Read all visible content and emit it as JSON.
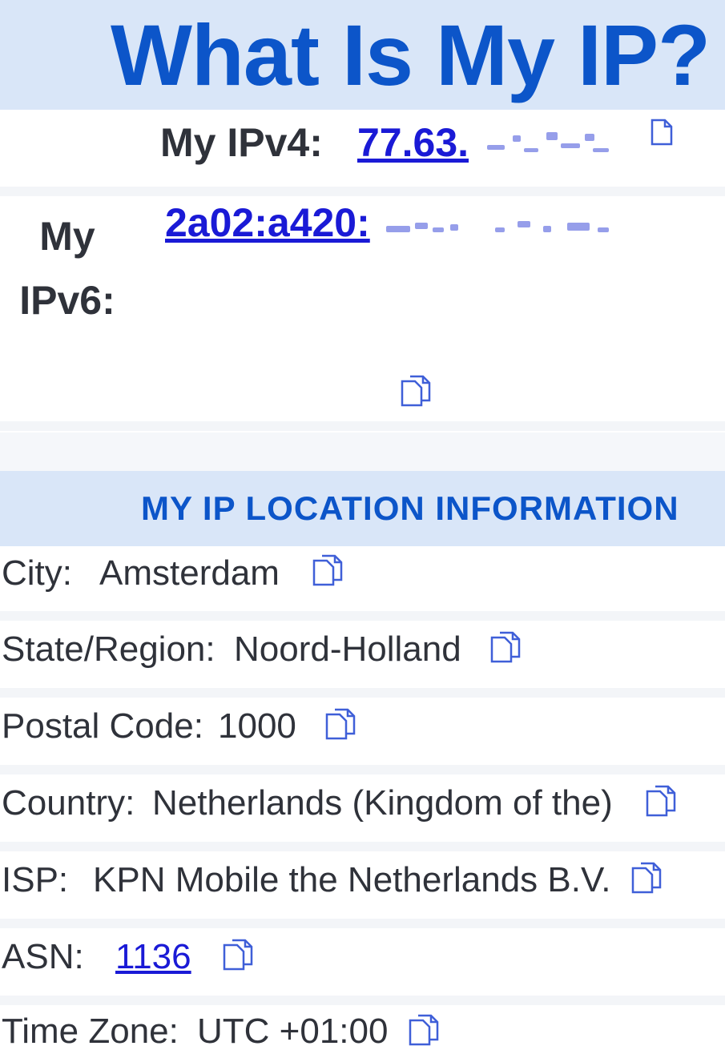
{
  "header": {
    "title": "What Is My IP?"
  },
  "ipv4": {
    "label": "My IPv4:",
    "value": "77.63."
  },
  "ipv6": {
    "label": "My IPv6:",
    "value": "2a02:a420:"
  },
  "location": {
    "title": "MY IP LOCATION INFORMATION",
    "rows": [
      {
        "label": "City:",
        "value": "Amsterdam"
      },
      {
        "label": "State/Region:",
        "value": "Noord-Holland"
      },
      {
        "label": "Postal Code:",
        "value": "1000"
      },
      {
        "label": "Country:",
        "value": "Netherlands (Kingdom of the)"
      },
      {
        "label": "ISP:",
        "value": "KPN Mobile the Netherlands B.V."
      },
      {
        "label": "ASN:",
        "value": "1136"
      },
      {
        "label": "Time Zone:",
        "value": "UTC +01:00"
      }
    ]
  },
  "icons": {
    "copy": "copy-icon"
  },
  "colors": {
    "brand": "#0c55c9",
    "header_bg": "#d9e6f8",
    "link": "#1a1ad6",
    "text": "#2f323a"
  }
}
